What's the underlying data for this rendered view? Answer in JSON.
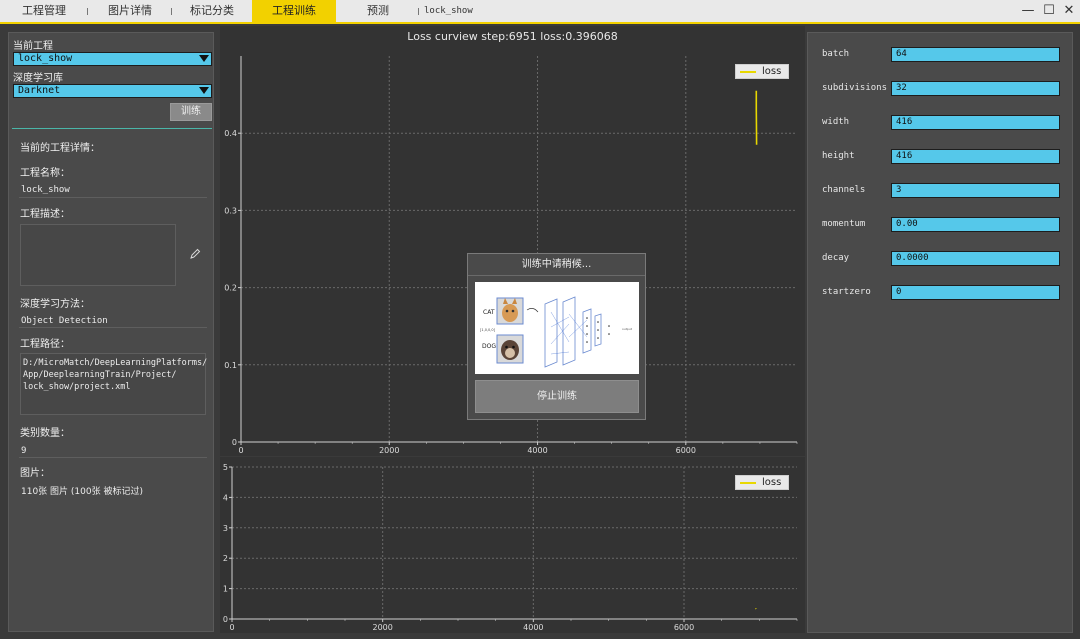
{
  "tabs": [
    {
      "label": "工程管理"
    },
    {
      "label": "图片详情"
    },
    {
      "label": "标记分类"
    },
    {
      "label": "工程训练"
    },
    {
      "label": "预测"
    }
  ],
  "project_tab_name": "lock_show",
  "window_controls": {
    "minimize": "—",
    "maximize": "☐",
    "close": "✕"
  },
  "left": {
    "current_project_label": "当前工程",
    "current_project_value": "lock_show",
    "dl_library_label": "深度学习库",
    "dl_library_value": "Darknet",
    "train_button": "训练",
    "details_header": "当前的工程详情：",
    "name_label": "工程名称：",
    "name_value": "lock_show",
    "desc_label": "工程描述：",
    "method_label": "深度学习方法：",
    "method_value": "Object Detection",
    "path_label": "工程路径：",
    "path_line1": "D:/MicroMatch/DeepLearningPlatforms/",
    "path_line2": "App/DeeplearningTrain/Project/",
    "path_line3": "lock_show/project.xml",
    "class_count_label": "类别数量：",
    "class_count_value": "9",
    "images_label": "图片：",
    "images_value": "110张  图片 (100张  被标记过)"
  },
  "plot_title": "Loss curview step:6951 loss:0.396068",
  "chart_data": [
    {
      "type": "line",
      "title": "Loss curview step:6951 loss:0.396068",
      "series": [
        {
          "name": "loss",
          "x": [
            6951,
            6951,
            6953,
            6955
          ],
          "y": [
            0.455,
            0.43,
            0.41,
            0.385
          ]
        }
      ],
      "xlim": [
        0,
        7500
      ],
      "ylim": [
        0,
        0.5
      ],
      "x_ticks": [
        0,
        2000,
        4000,
        6000
      ],
      "y_ticks": [
        0,
        0.1,
        0.2,
        0.3,
        0.4
      ],
      "x_tick_labels": [
        "0",
        "2000",
        "4000",
        "6000"
      ],
      "y_tick_labels": [
        "0",
        "0.1",
        "0.2",
        "0.3",
        "0.4"
      ],
      "grid": true,
      "legend": "top-right",
      "line_color": "#e8d800"
    },
    {
      "type": "line",
      "series": [
        {
          "name": "loss",
          "x": [
            6951,
            6955
          ],
          "y": [
            0.35,
            0.33
          ]
        }
      ],
      "xlim": [
        0,
        7500
      ],
      "ylim": [
        0,
        5
      ],
      "x_ticks": [
        0,
        2000,
        4000,
        6000
      ],
      "y_ticks": [
        0,
        1,
        2,
        3,
        4,
        5
      ],
      "x_tick_labels": [
        "0",
        "2000",
        "4000",
        "6000"
      ],
      "y_tick_labels": [
        "0",
        "1",
        "2",
        "3",
        "4",
        "5"
      ],
      "grid": true,
      "legend": "top-right",
      "line_color": "#e8d800"
    }
  ],
  "legend_label": "loss",
  "modal": {
    "title": "训练中请稍候...",
    "stop_button": "停止训练",
    "img_cat": "CAT",
    "img_dog": "DOG"
  },
  "params": [
    {
      "label": "batch",
      "value": "64"
    },
    {
      "label": "subdivisions",
      "value": "32"
    },
    {
      "label": "width",
      "value": "416"
    },
    {
      "label": "height",
      "value": "416"
    },
    {
      "label": "channels",
      "value": "3"
    },
    {
      "label": "momentum",
      "value": "0.00"
    },
    {
      "label": "decay",
      "value": "0.0000"
    },
    {
      "label": "startzero",
      "value": "0"
    }
  ],
  "colors": {
    "accent": "#f2d100",
    "input_bg": "#55c8ea",
    "teal": "#4ab6a8"
  }
}
